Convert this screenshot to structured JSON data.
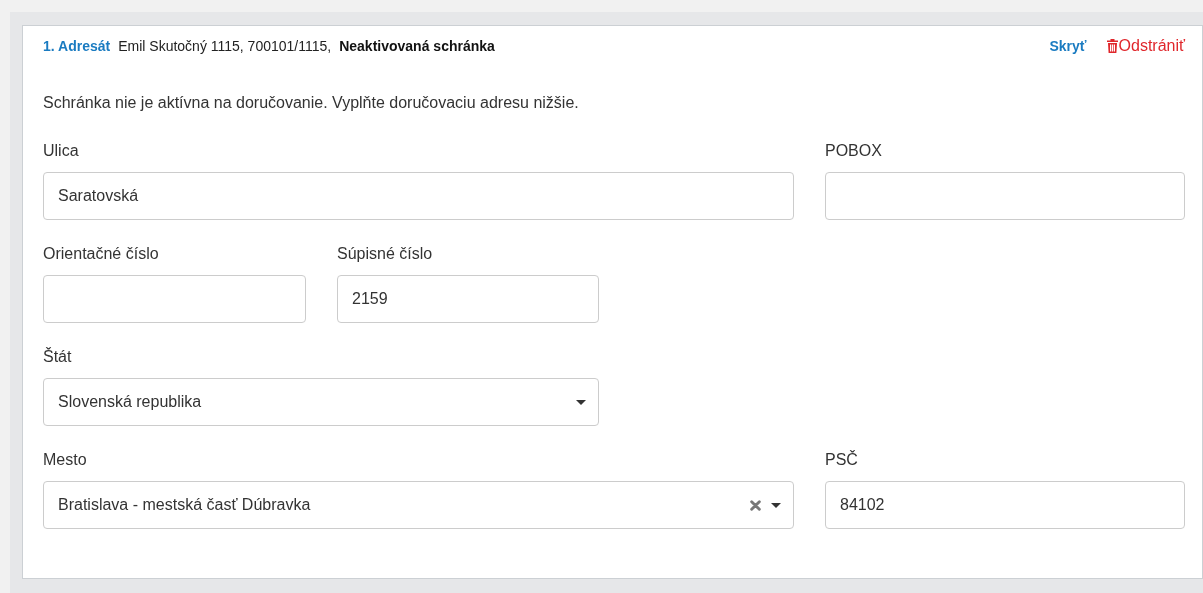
{
  "header": {
    "title": "1. Adresát",
    "recipient": "Emil Skutočný 1115, 700101/1115,",
    "status": "Neaktivovaná schránka",
    "hide_link": "Skryť",
    "remove_link": "Odstrániť"
  },
  "message": "Schránka nie je aktívna na doručovanie. Vyplňte doručovaciu adresu nižšie.",
  "rows": [
    [
      {
        "label": "Ulica",
        "kind": "text",
        "value": "Saratovská"
      },
      {
        "label": "POBOX",
        "kind": "text"
      }
    ],
    [
      {
        "label": "Orientačné číslo",
        "kind": "text"
      },
      {
        "label": "Súpisné číslo",
        "kind": "text",
        "value": "2159"
      }
    ],
    [
      {
        "label": "Štát",
        "kind": "select",
        "value": "Slovenská republika",
        "clearable": false
      }
    ],
    [
      {
        "label": "Mesto",
        "kind": "select",
        "value": "Bratislava - mestská časť Dúbravka",
        "clearable": true
      },
      {
        "label": "PSČ",
        "kind": "text",
        "value": "84102"
      }
    ]
  ]
}
